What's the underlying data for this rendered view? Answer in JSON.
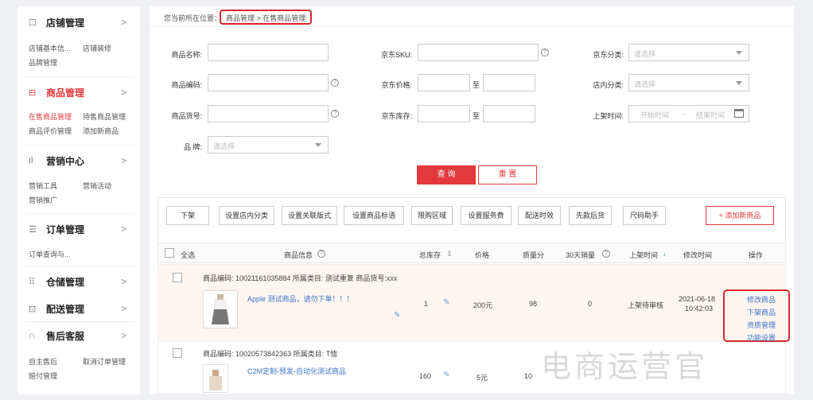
{
  "sidebar": {
    "sections": [
      {
        "title": "店铺管理",
        "items": [
          "店铺基本信...",
          "店铺装修",
          "品牌管理"
        ]
      },
      {
        "title": "商品管理",
        "items": [
          "在售商品管理",
          "待售商品管理",
          "商品评价管理",
          "添加新商品"
        ]
      },
      {
        "title": "营销中心",
        "items": [
          "营销工具",
          "营销活动",
          "营销推广"
        ]
      },
      {
        "title": "订单管理",
        "items": [
          "订单查询与..."
        ]
      },
      {
        "title": "仓储管理",
        "items": []
      },
      {
        "title": "配送管理",
        "items": []
      },
      {
        "title": "售后客服",
        "items": [
          "自主售后",
          "取消订单管理",
          "赔付管理"
        ]
      }
    ],
    "chevron": ">"
  },
  "breadcrumb": {
    "prefix": "您当前所在位置：",
    "path": "商品管理 > 在售商品管理"
  },
  "filters": {
    "product_name": "商品名称:",
    "jd_sku": "京东SKU:",
    "jd_category": "京东分类:",
    "product_code": "商品编码:",
    "jd_price": "京东价格:",
    "shop_category": "店内分类:",
    "product_number": "商品货号:",
    "jd_stock": "京东库存:",
    "listing_time": "上架时间:",
    "brand": "品 牌:",
    "select_placeholder": "请选择",
    "to": "至",
    "start_time": "开始时间",
    "end_time": "结束时间",
    "dash": "-"
  },
  "buttons": {
    "query": "查 询",
    "reset": "重 置"
  },
  "toolbar": [
    "下架",
    "设置店内分类",
    "设置关联版式",
    "设置商品标语",
    "限购区域",
    "设置服务费",
    "配送时效",
    "先款后货",
    "尺码助手"
  ],
  "add_product": "+ 添加新商品",
  "table": {
    "headers": [
      "全选",
      "商品信息",
      "总库存",
      "价格",
      "质量分",
      "30天销量",
      "上架时间",
      "修改时间",
      "操作"
    ]
  },
  "rows": [
    {
      "meta": "商品编码:  10021161035884 所属类目: 测试重复 商品货号:xxx",
      "name": "Apple 测试商品，请勿下单！！！",
      "stock": "1",
      "price": "200元",
      "quality": "98",
      "sales": "0",
      "status": "上架待审核",
      "modified_date": "2021-06-18",
      "modified_time": "10:42:03",
      "ops": [
        "修改商品",
        "下架商品",
        "资质管理",
        "功能设置"
      ]
    },
    {
      "meta": "商品编码:  10020573842363 所属类目: T恤",
      "name": "C2M定制-预发-自动化测试商品",
      "stock": "160",
      "price": "5元",
      "quality": "10"
    }
  ],
  "watermark": "电商运营官",
  "colors": {
    "accent": "#e4393c",
    "link": "#3d74c7",
    "highlight_box": "#d9262c"
  }
}
